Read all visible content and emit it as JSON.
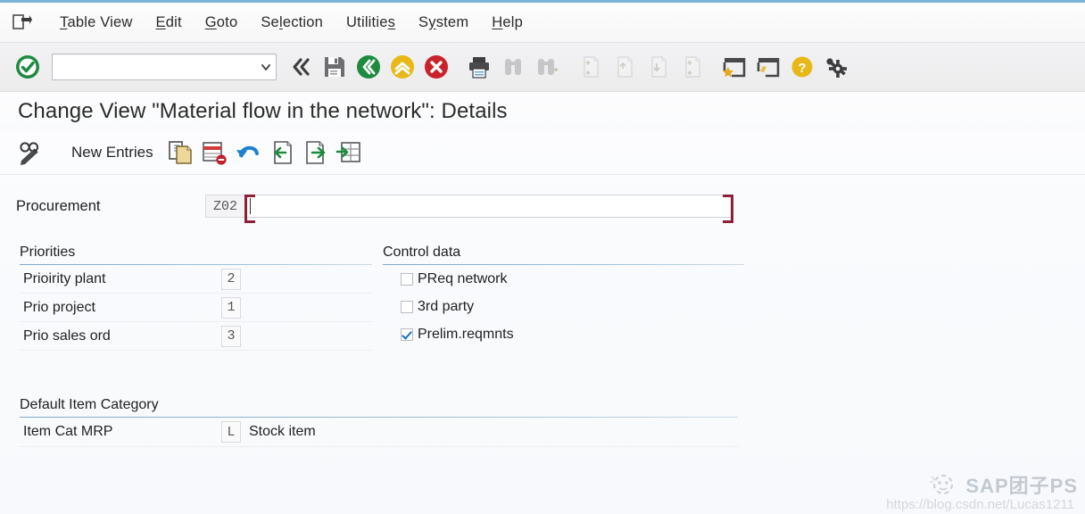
{
  "menu": {
    "system_icon": "window-exit-icon",
    "items": [
      {
        "label": "Table View",
        "mnemonic": "T"
      },
      {
        "label": "Edit",
        "mnemonic": "E"
      },
      {
        "label": "Goto",
        "mnemonic": "G"
      },
      {
        "label": "Selection",
        "mnemonic": "l"
      },
      {
        "label": "Utilities",
        "mnemonic": "s"
      },
      {
        "label": "System",
        "mnemonic": "y"
      },
      {
        "label": "Help",
        "mnemonic": "H"
      }
    ]
  },
  "toolbar": {
    "enter_icon": "green-check-enter-icon",
    "command_value": "",
    "command_placeholder": "",
    "dropdown_icon": "chevron-down-icon",
    "icons": [
      {
        "name": "double-chevron-left-icon",
        "enabled": true
      },
      {
        "name": "save-floppy-icon",
        "enabled": true
      },
      {
        "name": "back-green-icon",
        "enabled": true
      },
      {
        "name": "exit-up-yellow-icon",
        "enabled": true
      },
      {
        "name": "cancel-red-icon",
        "enabled": true
      },
      {
        "name": "print-icon",
        "enabled": true
      },
      {
        "name": "find-icon",
        "enabled": false
      },
      {
        "name": "find-next-icon",
        "enabled": false
      },
      {
        "name": "first-page-icon",
        "enabled": false
      },
      {
        "name": "previous-page-icon",
        "enabled": false
      },
      {
        "name": "next-page-icon",
        "enabled": false
      },
      {
        "name": "last-page-icon",
        "enabled": false
      },
      {
        "name": "create-session-icon",
        "enabled": true
      },
      {
        "name": "create-shortcut-icon",
        "enabled": true
      },
      {
        "name": "help-question-icon",
        "enabled": true
      },
      {
        "name": "customize-gear-icon",
        "enabled": true
      }
    ]
  },
  "title": "Change View \"Material flow in the network\": Details",
  "app_toolbar": {
    "display_change_icon": "display-change-icon",
    "new_entries_label": "New Entries",
    "icons": [
      {
        "name": "copy-as-icon"
      },
      {
        "name": "delete-row-icon"
      },
      {
        "name": "undo-icon"
      },
      {
        "name": "previous-entry-icon"
      },
      {
        "name": "next-entry-icon"
      },
      {
        "name": "variable-list-icon"
      }
    ]
  },
  "form": {
    "procurement": {
      "label": "Procurement",
      "code": "Z02",
      "value": "",
      "focused": true
    },
    "priorities": {
      "title": "Priorities",
      "rows": [
        {
          "label": "Prioirity plant",
          "value": "2"
        },
        {
          "label": "Prio project",
          "value": "1"
        },
        {
          "label": "Prio sales ord",
          "value": "3"
        }
      ]
    },
    "control_data": {
      "title": "Control data",
      "checkboxes": [
        {
          "label": "PReq network",
          "checked": false
        },
        {
          "label": "3rd party",
          "checked": false
        },
        {
          "label": "Prelim.reqmnts",
          "checked": true
        }
      ]
    },
    "default_item_category": {
      "title": "Default Item Category",
      "row": {
        "label": "Item Cat MRP",
        "code": "L",
        "description": "Stock item"
      }
    }
  },
  "watermark": {
    "logo_text": "SAP团子PS",
    "url": "https://blog.csdn.net/Lucas1211"
  },
  "colors": {
    "accent_blue": "#7fa8c9",
    "focus_red": "#8e2036",
    "check_blue": "#1a6fc4",
    "green": "#1d8a3f",
    "yellow": "#e8b818",
    "red": "#c9222a"
  }
}
